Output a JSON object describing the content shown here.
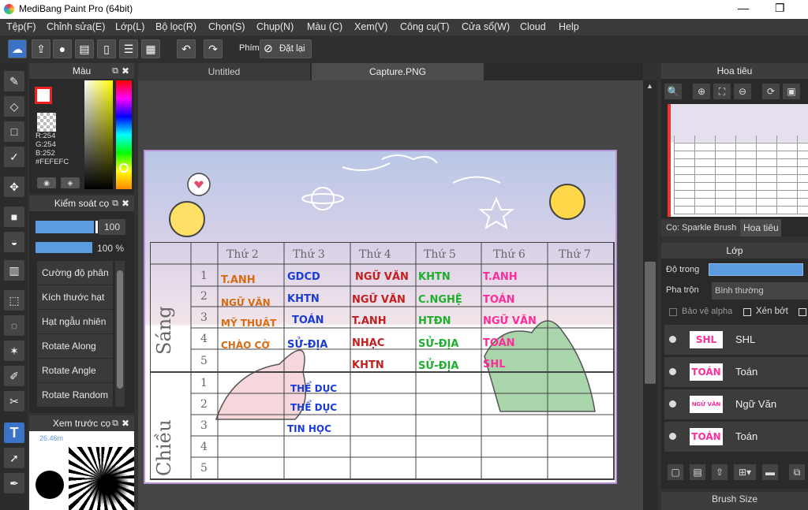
{
  "app": {
    "title": "MediBang Paint Pro (64bit)",
    "min": "—",
    "restore": "❐"
  },
  "menu": [
    "Tệp(F)",
    "Chỉnh sửa(E)",
    "Lớp(L)",
    "Bộ lọc(R)",
    "Chọn(S)",
    "Chụp(N)",
    "Màu (C)",
    "Xem(V)",
    "Công cụ(T)",
    "Cửa sổ(W)",
    "Cloud",
    "Help"
  ],
  "toolbar": {
    "shortcut_label": "Phím",
    "reset_label": "Đặt lại"
  },
  "color_panel": {
    "title": "Màu",
    "r": "R:254",
    "g": "G:254",
    "b": "B:252",
    "hex": "#FEFEFC"
  },
  "brush_control": {
    "title": "Kiểm soát cọ",
    "size_value": "100",
    "opacity_value": "100 %",
    "items": [
      "Cường độ phân",
      "Kích thước hạt",
      "Hạt ngẫu nhiên",
      "Rotate Along",
      "Rotate Angle",
      "Rotate Random"
    ]
  },
  "preview": {
    "title": "Xem trước cọ",
    "size": "26.46m"
  },
  "tabs": [
    "Untitled",
    "Capture.PNG"
  ],
  "navigator": {
    "title": "Hoa tiêu",
    "brush_tab": "Cọ: Sparkle Brush",
    "nav_tab": "Hoa tiêu"
  },
  "layers": {
    "title": "Lớp",
    "opacity_label": "Độ trong",
    "blend_label": "Pha trộn",
    "blend_value": "Bình thường",
    "protect_alpha": "Bảo vệ alpha",
    "clipping": "Xén bớt",
    "items": [
      {
        "thumb": "SHL",
        "name": "SHL"
      },
      {
        "thumb": "TOÁN",
        "name": "Toán"
      },
      {
        "thumb": "NGỮ VĂN",
        "name": "Ngữ Văn"
      },
      {
        "thumb": "TOÁN",
        "name": "Toán"
      }
    ]
  },
  "brush_size": {
    "title": "Brush Size"
  },
  "schedule": {
    "days": [
      "Thứ 2",
      "Thứ 3",
      "Thứ 4",
      "Thứ 5",
      "Thứ 6",
      "Thứ 7"
    ],
    "morning_label": "Sáng",
    "afternoon_label": "Chiều",
    "periods": [
      "1",
      "2",
      "3",
      "4",
      "5",
      "1",
      "2",
      "3",
      "4",
      "5"
    ],
    "mon": [
      "T.ANH",
      "NGỮ VĂN",
      "MỸ THUẬT",
      "CHÀO CỜ"
    ],
    "tue": [
      "GDCD",
      "KHTN",
      "TOÁN",
      "SỬ-ĐỊA"
    ],
    "wed": [
      "NGỮ VĂN",
      "NGỮ VĂN",
      "T.ANH",
      "NHẠC",
      "KHTN"
    ],
    "thu": [
      "KHTN",
      "C.NGHỆ",
      "HTĐN",
      "SỬ-ĐỊA",
      "SỬ-ĐỊA"
    ],
    "fri": [
      "T.ANH",
      "TOÁN",
      "NGỮ VĂN",
      "TOÁN",
      "SHL"
    ],
    "tue_pm": [
      "THỂ DỤC",
      "THỂ DỤC",
      "TIN HỌC"
    ]
  },
  "colors": {
    "accent": "#3b74c7",
    "frame": "#b693d8",
    "mon": "#d86a10",
    "tue": "#1a3bd8",
    "wed": "#c2201f",
    "thu": "#1fae2d",
    "fri": "#ff2d9a"
  }
}
